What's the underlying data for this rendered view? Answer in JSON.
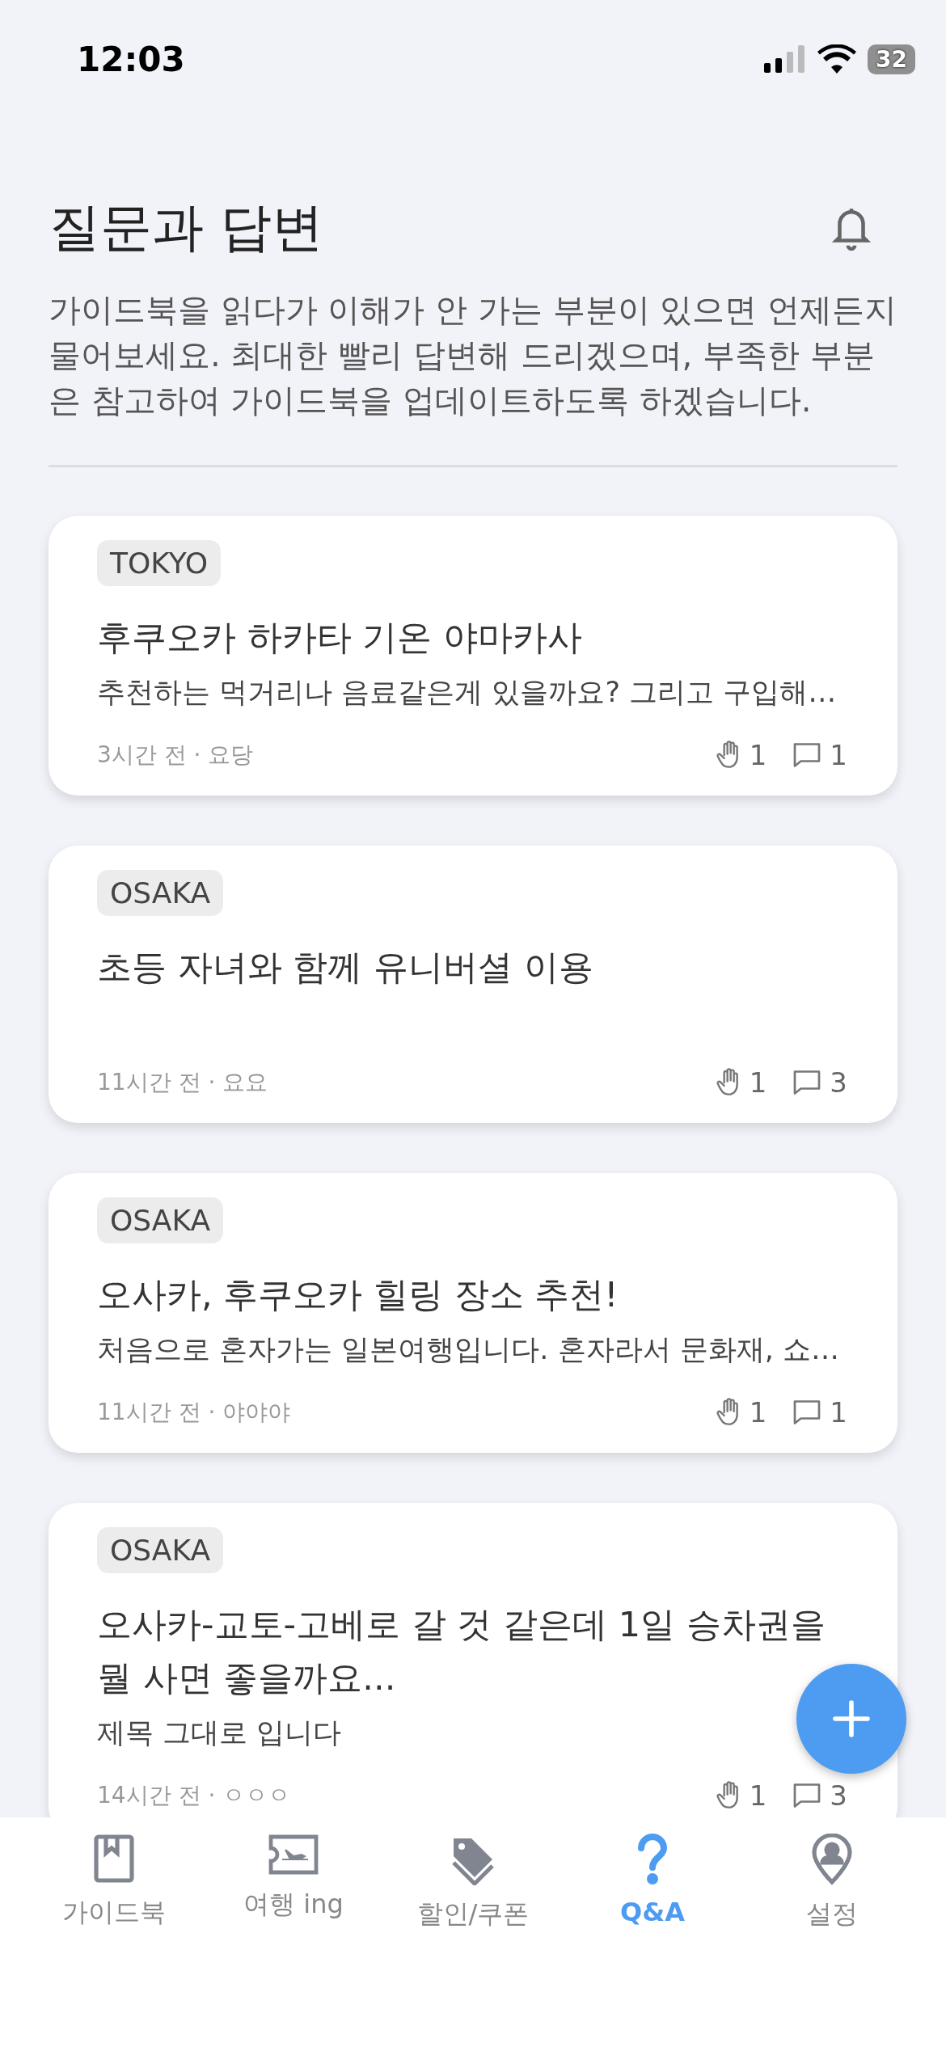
{
  "status_bar": {
    "time": "12:03",
    "battery": "32"
  },
  "header": {
    "title": "질문과 답변",
    "description": "가이드북을 읽다가 이해가 안 가는 부분이 있으면 언제든지 물어보세요. 최대한 빨리 답변해 드리겠으며, 부족한 부분은 참고하여 가이드북을 업데이트하도록 하겠습니다."
  },
  "questions": [
    {
      "tag": "TOKYO",
      "title": "후쿠오카 하카타 기온 야마카사",
      "snippet": "추천하는 먹거리나 음료같은게 있을까요? 그리고 구입해…",
      "meta": "3시간 전 · 요당",
      "likes": "1",
      "comments": "1"
    },
    {
      "tag": "OSAKA",
      "title": "초등 자녀와 함께 유니버셜 이용",
      "meta": "11시간 전 · 요요",
      "likes": "1",
      "comments": "3"
    },
    {
      "tag": "OSAKA",
      "title": "오사카, 후쿠오카 힐링 장소 추천!",
      "snippet": "처음으로 혼자가는 일본여행입니다. 혼자라서 문화재, 쇼…",
      "meta": "11시간 전 · 야야야",
      "likes": "1",
      "comments": "1"
    },
    {
      "tag": "OSAKA",
      "title": "오사카-교토-고베로 갈 것 같은데 1일 승차권을 뭘 사면 좋을까요...",
      "snippet": "제목 그대로 입니다",
      "meta": "14시간 전 · ㅇㅇㅇ",
      "likes": "1",
      "comments": "3"
    }
  ],
  "tabs": [
    {
      "kind": "guidebook",
      "label": "가이드북",
      "selected": false
    },
    {
      "kind": "trip",
      "label": "여행 ing",
      "selected": false
    },
    {
      "kind": "coupon",
      "label": "할인/쿠폰",
      "selected": false
    },
    {
      "kind": "qna",
      "label": "Q&A",
      "selected": true
    },
    {
      "kind": "settings",
      "label": "설정",
      "selected": false
    }
  ]
}
